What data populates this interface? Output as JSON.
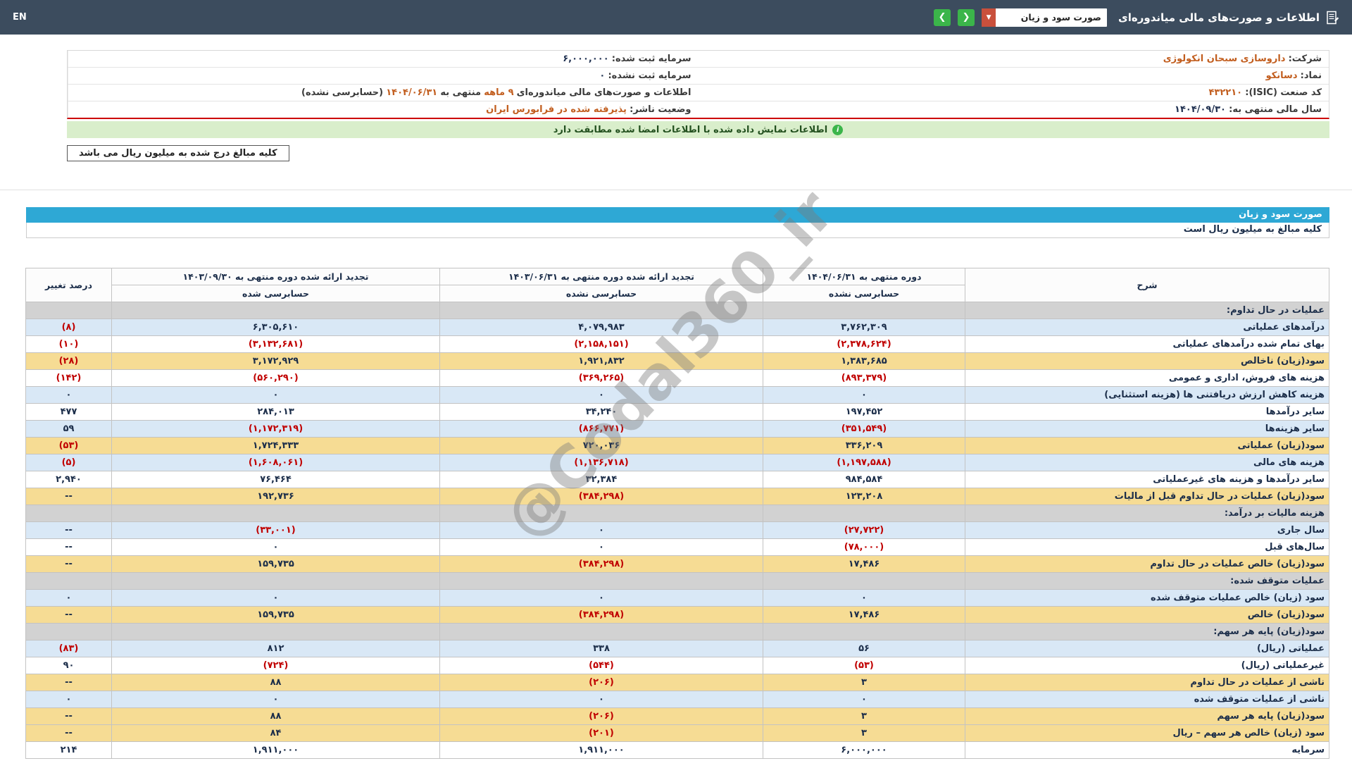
{
  "colors": {
    "topbar_bg": "#3c4c5e",
    "accent_green": "#3bb54a",
    "select_caret_bg": "#c9503c",
    "statement_title_blue": "#2ea8d5",
    "row_blue": "#d9e8f6",
    "row_yellow": "#f6dc94",
    "row_section_gray": "#d2d2d2",
    "negative_red": "#c00000",
    "highlight_orange": "#c25e1f",
    "banner_green_bg": "#d9eecb",
    "red_divider": "#cc0000"
  },
  "topbar": {
    "title": "اطلاعات و صورت‌های مالی میاندوره‌ای",
    "statement_select_value": "صورت سود و زیان",
    "caret": "▼",
    "prev_button": "❮",
    "next_button": "❯",
    "language_link": "EN"
  },
  "company_info": {
    "company_label": "شرکت:",
    "company_value": "داروسازی سبحان انکولوژی",
    "registered_capital_label": "سرمایه ثبت شده:",
    "registered_capital_value": "۶,۰۰۰,۰۰۰",
    "symbol_label": "نماد:",
    "symbol_value": "دسانکو",
    "unregistered_capital_label": "سرمایه ثبت نشده:",
    "unregistered_capital_value": "۰",
    "isic_label": "کد صنعت (ISIC):",
    "isic_value": "۴۳۲۲۱۰",
    "period_prefix": "اطلاعات و صورت‌های مالی میاندوره‌ای",
    "period_months": "۹ ماهه",
    "period_mid": "منتهی به",
    "period_date": "۱۴۰۴/۰۶/۳۱",
    "period_suffix": "(حسابرسی نشده)",
    "fiscal_year_label": "سال مالی منتهی به:",
    "fiscal_year_value": "۱۴۰۴/۰۹/۳۰",
    "publisher_status_label": "وضعیت ناشر:",
    "publisher_status_value": "پذیرفته شده در فرابورس ایران"
  },
  "signature_banner": "اطلاعات نمایش داده شده با اطلاعات امضا شده مطابقت دارد",
  "units_box": "کلیه مبالغ درج شده به میلیون ریال می باشد",
  "statement": {
    "title": "صورت سود و زیان",
    "units_note": "کلیه مبالغ به میلیون ریال است",
    "header": {
      "description": "شرح",
      "change": "درصد تغییر",
      "columns": [
        {
          "title": "دوره منتهی به ۱۴۰۴/۰۶/۳۱",
          "sub": "حسابرسی نشده"
        },
        {
          "title": "تجدید ارائه شده دوره منتهی به ۱۴۰۳/۰۶/۳۱",
          "sub": "حسابرسی نشده"
        },
        {
          "title": "تجدید ارائه شده دوره منتهی به ۱۴۰۳/۰۹/۳۰",
          "sub": "حسابرسی شده"
        }
      ]
    },
    "rows": [
      {
        "type": "section",
        "label": "عملیات در حال تداوم:"
      },
      {
        "type": "data",
        "shade": "blue",
        "label": "درآمدهای عملیاتی",
        "values": [
          "۳,۷۶۲,۳۰۹",
          "۴,۰۷۹,۹۸۳",
          "۶,۳۰۵,۶۱۰"
        ],
        "change": "(۸)"
      },
      {
        "type": "data",
        "shade": "white",
        "label": "بهای تمام شده درآمدهای عملیاتی",
        "values": [
          "(۲,۳۷۸,۶۲۴)",
          "(۲,۱۵۸,۱۵۱)",
          "(۳,۱۳۲,۶۸۱)"
        ],
        "change": "(۱۰)"
      },
      {
        "type": "data",
        "shade": "yellow",
        "label": "سود(زیان) ناخالص",
        "values": [
          "۱,۳۸۳,۶۸۵",
          "۱,۹۲۱,۸۳۲",
          "۳,۱۷۲,۹۲۹"
        ],
        "change": "(۲۸)"
      },
      {
        "type": "data",
        "shade": "white",
        "label": "هزینه های فروش، اداری و عمومی",
        "values": [
          "(۸۹۳,۳۷۹)",
          "(۳۶۹,۲۶۵)",
          "(۵۶۰,۲۹۰)"
        ],
        "change": "(۱۴۲)"
      },
      {
        "type": "data",
        "shade": "blue",
        "label": "هزینه کاهش ارزش دریافتنی ها (هزینه استثنایی)",
        "values": [
          "۰",
          "۰",
          "۰"
        ],
        "change": "۰"
      },
      {
        "type": "data",
        "shade": "white",
        "label": "سایر درآمدها",
        "values": [
          "۱۹۷,۴۵۲",
          "۳۴,۲۴۰",
          "۲۸۴,۰۱۳"
        ],
        "change": "۴۷۷"
      },
      {
        "type": "data",
        "shade": "blue",
        "label": "سایر هزینه‌ها",
        "values": [
          "(۳۵۱,۵۴۹)",
          "(۸۶۶,۷۷۱)",
          "(۱,۱۷۲,۳۱۹)"
        ],
        "change": "۵۹"
      },
      {
        "type": "data",
        "shade": "yellow",
        "label": "سود(زیان) عملیاتی",
        "values": [
          "۳۳۶,۲۰۹",
          "۷۲۰,۰۳۶",
          "۱,۷۲۴,۳۳۳"
        ],
        "change": "(۵۳)"
      },
      {
        "type": "data",
        "shade": "blue",
        "label": "هزینه های مالی",
        "values": [
          "(۱,۱۹۷,۵۸۸)",
          "(۱,۱۳۶,۷۱۸)",
          "(۱,۶۰۸,۰۶۱)"
        ],
        "change": "(۵)"
      },
      {
        "type": "data",
        "shade": "white",
        "label": "سایر درآمدها و هزینه های غیرعملیاتی",
        "values": [
          "۹۸۴,۵۸۴",
          "۳۲,۳۸۴",
          "۷۶,۴۶۴"
        ],
        "change": "۲,۹۴۰"
      },
      {
        "type": "data",
        "shade": "yellow",
        "label": "سود(زیان) عملیات در حال تداوم قبل از مالیات",
        "values": [
          "۱۲۳,۲۰۸",
          "(۳۸۴,۲۹۸)",
          "۱۹۲,۷۳۶"
        ],
        "change": "--"
      },
      {
        "type": "section",
        "label": "هزینه مالیات بر درآمد:"
      },
      {
        "type": "data",
        "shade": "blue",
        "label": "سال جاری",
        "values": [
          "(۲۷,۷۲۲)",
          "۰",
          "(۳۳,۰۰۱)"
        ],
        "change": "--"
      },
      {
        "type": "data",
        "shade": "white",
        "label": "سال‌های قبل",
        "values": [
          "(۷۸,۰۰۰)",
          "۰",
          "۰"
        ],
        "change": "--"
      },
      {
        "type": "data",
        "shade": "yellow",
        "label": "سود(زیان) خالص عملیات در حال تداوم",
        "values": [
          "۱۷,۴۸۶",
          "(۳۸۴,۲۹۸)",
          "۱۵۹,۷۳۵"
        ],
        "change": "--"
      },
      {
        "type": "section",
        "label": "عملیات متوقف شده:"
      },
      {
        "type": "data",
        "shade": "blue",
        "label": "سود (زیان) خالص عملیات متوقف شده",
        "values": [
          "۰",
          "۰",
          "۰"
        ],
        "change": "۰"
      },
      {
        "type": "data",
        "shade": "yellow",
        "label": "سود(زیان) خالص",
        "values": [
          "۱۷,۴۸۶",
          "(۳۸۴,۲۹۸)",
          "۱۵۹,۷۳۵"
        ],
        "change": "--"
      },
      {
        "type": "section",
        "label": "سود(زیان) پایه هر سهم:"
      },
      {
        "type": "data",
        "shade": "blue",
        "label": "عملیاتی (ریال)",
        "values": [
          "۵۶",
          "۳۳۸",
          "۸۱۲"
        ],
        "change": "(۸۳)"
      },
      {
        "type": "data",
        "shade": "white",
        "label": "غیرعملیاتی (ریال)",
        "values": [
          "(۵۳)",
          "(۵۴۴)",
          "(۷۲۴)"
        ],
        "change": "۹۰"
      },
      {
        "type": "data",
        "shade": "yellow",
        "label": "ناشی از عملیات در حال تداوم",
        "values": [
          "۳",
          "(۲۰۶)",
          "۸۸"
        ],
        "change": "--"
      },
      {
        "type": "data",
        "shade": "blue",
        "label": "ناشی از عملیات متوقف شده",
        "values": [
          "۰",
          "۰",
          "۰"
        ],
        "change": "۰"
      },
      {
        "type": "data",
        "shade": "yellow",
        "label": "سود(زیان) پایه هر سهم",
        "values": [
          "۳",
          "(۲۰۶)",
          "۸۸"
        ],
        "change": "--"
      },
      {
        "type": "data",
        "shade": "yellow",
        "label": "سود (زیان) خالص هر سهم – ریال",
        "values": [
          "۳",
          "(۲۰۱)",
          "۸۴"
        ],
        "change": "--"
      },
      {
        "type": "data",
        "shade": "white",
        "label": "سرمایه",
        "values": [
          "۶,۰۰۰,۰۰۰",
          "۱,۹۱۱,۰۰۰",
          "۱,۹۱۱,۰۰۰"
        ],
        "change": "۲۱۴"
      }
    ]
  },
  "watermark": "@Codal360_ir"
}
